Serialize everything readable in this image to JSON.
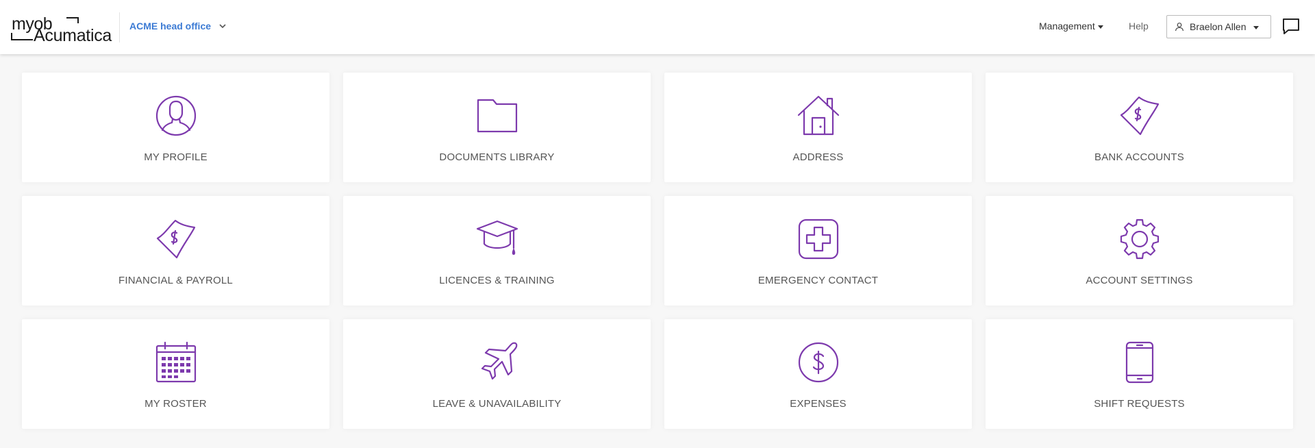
{
  "header": {
    "logo_top": "myob",
    "logo_bottom": "Acumatica",
    "company": "ACME head office",
    "management": "Management",
    "help": "Help",
    "user": "Braelon Allen"
  },
  "icons": {
    "company_chevron": "chevron-down-icon",
    "user": "user-icon",
    "chat": "chat-icon"
  },
  "accent_color": "#7d3aad",
  "link_color": "#3c7bd4",
  "tiles": [
    {
      "label": "MY PROFILE",
      "icon": "profile-icon"
    },
    {
      "label": "DOCUMENTS LIBRARY",
      "icon": "folder-icon"
    },
    {
      "label": "ADDRESS",
      "icon": "house-icon"
    },
    {
      "label": "BANK ACCOUNTS",
      "icon": "banknote-icon"
    },
    {
      "label": "FINANCIAL & PAYROLL",
      "icon": "banknote-icon"
    },
    {
      "label": "LICENCES & TRAINING",
      "icon": "graduation-cap-icon"
    },
    {
      "label": "EMERGENCY CONTACT",
      "icon": "medical-cross-icon"
    },
    {
      "label": "ACCOUNT SETTINGS",
      "icon": "gear-icon"
    },
    {
      "label": "MY ROSTER",
      "icon": "calendar-icon"
    },
    {
      "label": "LEAVE & UNAVAILABILITY",
      "icon": "airplane-icon"
    },
    {
      "label": "EXPENSES",
      "icon": "dollar-coin-icon"
    },
    {
      "label": "SHIFT REQUESTS",
      "icon": "mobile-phone-icon"
    }
  ]
}
